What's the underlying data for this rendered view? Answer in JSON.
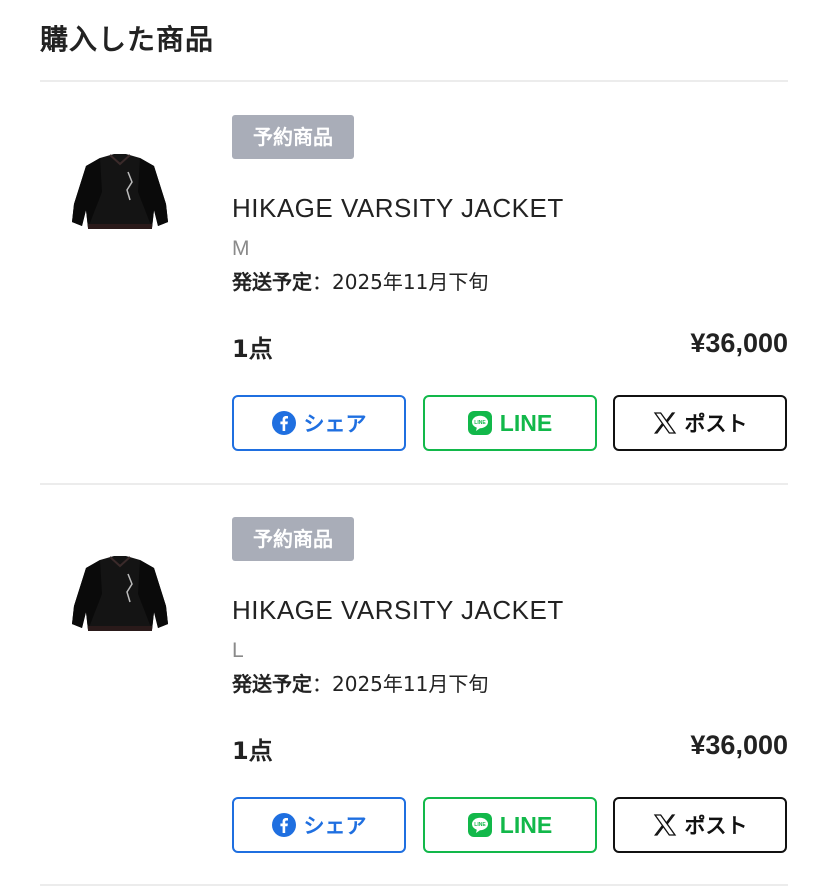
{
  "page": {
    "title": "購入した商品"
  },
  "colors": {
    "badge_bg": "#a9adb8",
    "facebook": "#1f6fe0",
    "line": "#12b84a",
    "x": "#111111",
    "divider": "#ececec"
  },
  "items": [
    {
      "badge": "予約商品",
      "name": "HIKAGE VARSITY JACKET",
      "size": "M",
      "ship_label": "発送予定",
      "ship_sep": "：",
      "ship_value": "2025年11月下旬",
      "quantity": "1点",
      "price": "¥36,000",
      "thumbnail_icon": "varsity-jacket-image",
      "share": {
        "facebook": "シェア",
        "line": "LINE",
        "x": "ポスト"
      }
    },
    {
      "badge": "予約商品",
      "name": "HIKAGE VARSITY JACKET",
      "size": "L",
      "ship_label": "発送予定",
      "ship_sep": "：",
      "ship_value": "2025年11月下旬",
      "quantity": "1点",
      "price": "¥36,000",
      "thumbnail_icon": "varsity-jacket-image",
      "share": {
        "facebook": "シェア",
        "line": "LINE",
        "x": "ポスト"
      }
    }
  ]
}
